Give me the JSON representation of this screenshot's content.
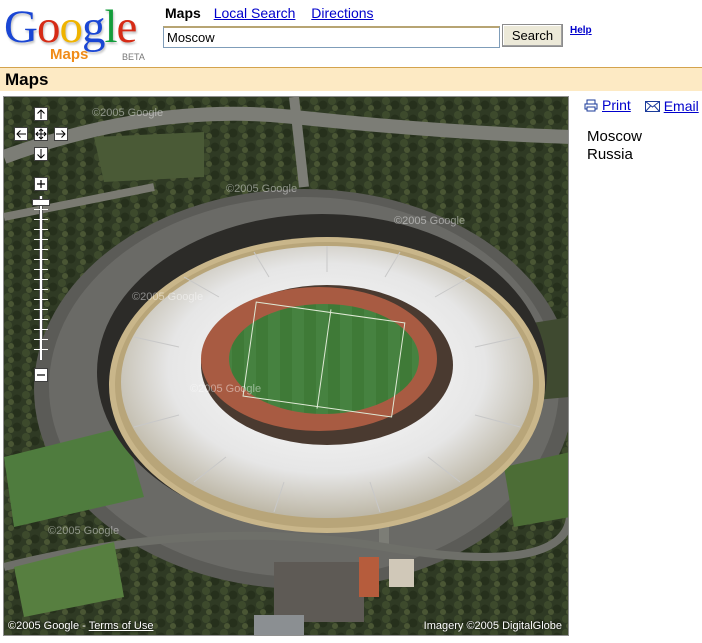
{
  "header": {
    "logo_text": "Google",
    "logo_sub": "Maps",
    "logo_beta": "BETA",
    "nav": {
      "current": "Maps",
      "links": [
        "Local Search",
        "Directions"
      ]
    },
    "search": {
      "value": "Moscow",
      "button": "Search"
    },
    "help": "Help"
  },
  "section_title": "Maps",
  "map": {
    "watermark_text": "©2005 Google",
    "copyright": "©2005 Google - ",
    "terms": "Terms of Use",
    "imagery": "Imagery ©2005 DigitalGlobe",
    "controls": {
      "pan": [
        "pan-up-icon",
        "pan-left-icon",
        "pan-center-icon",
        "pan-right-icon",
        "pan-down-icon"
      ],
      "zoom": [
        "zoom-in-icon",
        "zoom-out-icon"
      ]
    }
  },
  "sidebar": {
    "print": "Print",
    "email": "Email",
    "result": {
      "line1": "Moscow",
      "line2": "Russia"
    }
  },
  "colors": {
    "link": "#0000cc",
    "title_bar": "#fdeac4",
    "title_border": "#d4a34d"
  }
}
